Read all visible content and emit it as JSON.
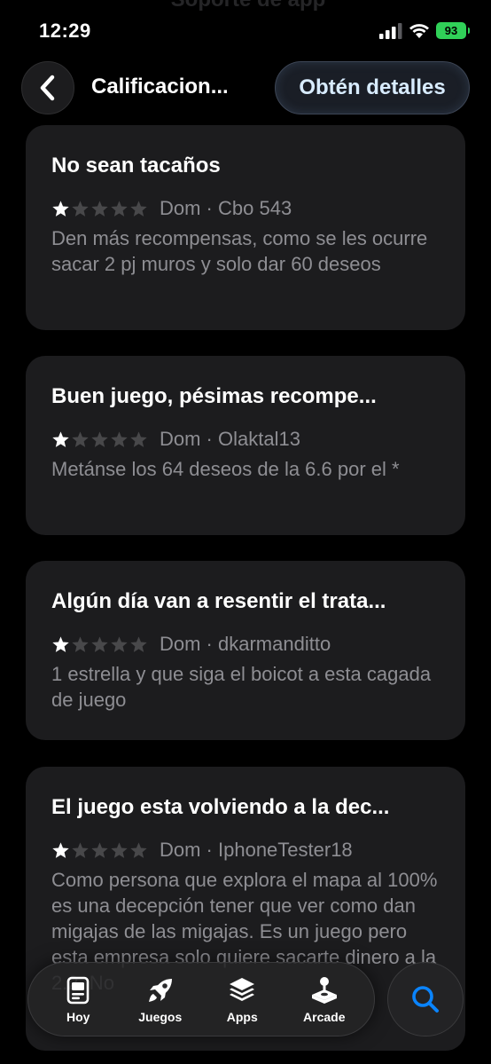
{
  "status_bar": {
    "time": "12:29",
    "battery": "93",
    "battery_color": "#30d158",
    "ghost_text": "Soporte de app"
  },
  "nav": {
    "title": "Calificacion...",
    "get_details_label": "Obtén detalles",
    "back_icon": "chevron-left-icon"
  },
  "reviews": [
    {
      "title": "No sean tacaños",
      "rating": 1,
      "max_rating": 5,
      "meta": "Dom · Cbo 543",
      "body": "Den más recompensas, como se les ocurre sacar 2 pj muros y solo dar 60 deseos"
    },
    {
      "title": "Buen juego, pésimas recompe...",
      "rating": 1,
      "max_rating": 5,
      "meta": "Dom · Olaktal13",
      "body": "Metánse los 64 deseos de la 6.6 por el *"
    },
    {
      "title": "Algún día van a resentir el trata...",
      "rating": 1,
      "max_rating": 5,
      "meta": "Dom · dkarmanditto",
      "body": "1 estrella y que siga el boicot a esta cagada de juego"
    },
    {
      "title": "El juego esta volviendo a la dec...",
      "rating": 1,
      "max_rating": 5,
      "meta": "Dom · IphoneTester18",
      "body": "Como persona que explora el mapa al 100% es una decepción tener que ver como dan migajas de las migajas. Es un juego pero esta empresa solo quiere sacarte dinero a la 2.2. No"
    }
  ],
  "tabbar": {
    "tabs": [
      {
        "label": "Hoy",
        "icon": "today-icon"
      },
      {
        "label": "Juegos",
        "icon": "rocket-icon"
      },
      {
        "label": "Apps",
        "icon": "layers-icon"
      },
      {
        "label": "Arcade",
        "icon": "joystick-icon"
      }
    ],
    "search_icon": "search-icon",
    "accent": "#0a84ff"
  }
}
